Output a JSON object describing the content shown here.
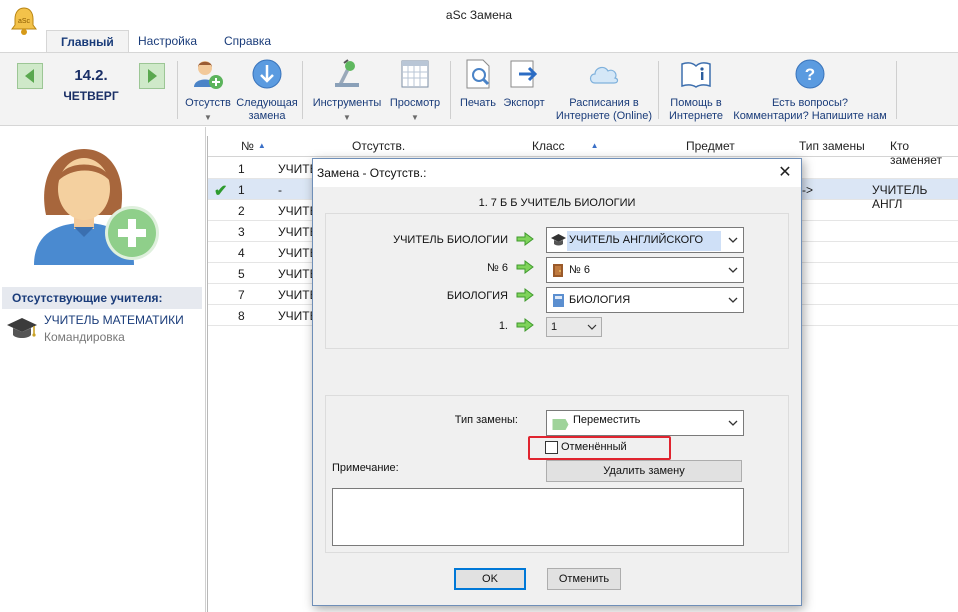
{
  "window": {
    "title": "aSc Замена"
  },
  "tabs": [
    {
      "label": "Главный"
    },
    {
      "label": "Настройка"
    },
    {
      "label": "Справка"
    }
  ],
  "ribbon": {
    "date": "14.2.",
    "weekday": "ЧЕТВЕРГ",
    "buttons": {
      "absent": {
        "line1": "Отсутств",
        "line2": ""
      },
      "next": {
        "line1": "Следующая",
        "line2": "замена"
      },
      "tools": {
        "line1": "Инструменты",
        "line2": ""
      },
      "view": {
        "line1": "Просмотр",
        "line2": ""
      },
      "print": {
        "line1": "Печать",
        "line2": ""
      },
      "export": {
        "line1": "Экспорт",
        "line2": ""
      },
      "online": {
        "line1": "Расписания в",
        "line2": "Интернете (Online)"
      },
      "help": {
        "line1": "Помощь в",
        "line2": "Интернете"
      },
      "questions": {
        "line1": "Есть вопросы?",
        "line2": "Комментарии? Напишите нам"
      }
    }
  },
  "left_panel": {
    "absent_header": "Отсутствующие учителя:",
    "absent_teachers": [
      {
        "name": "УЧИТЕЛЬ МАТЕМАТИКИ",
        "reason": "Командировка"
      }
    ]
  },
  "grid": {
    "columns": [
      "№",
      "Отсутств.",
      "Класс",
      "Предмет",
      "Тип замены",
      "Кто заменяет"
    ],
    "rows": [
      {
        "num": "1",
        "teacher": "УЧИТЕ",
        "check": "",
        "arrow": "",
        "kto": ""
      },
      {
        "num": "1",
        "teacher": "-",
        "check": "✔",
        "arrow": "->",
        "kto": "УЧИТЕЛЬ АНГЛ"
      },
      {
        "num": "2",
        "teacher": "УЧИТЕ",
        "check": "",
        "arrow": "",
        "kto": ""
      },
      {
        "num": "3",
        "teacher": "УЧИТЕ",
        "check": "",
        "arrow": "",
        "kto": ""
      },
      {
        "num": "4",
        "teacher": "УЧИТЕ",
        "check": "",
        "arrow": "",
        "kto": ""
      },
      {
        "num": "5",
        "teacher": "УЧИТЕ",
        "check": "",
        "arrow": "",
        "kto": ""
      },
      {
        "num": "7",
        "teacher": "УЧИТЕ",
        "check": "",
        "arrow": "",
        "kto": ""
      },
      {
        "num": "8",
        "teacher": "УЧИТЕ",
        "check": "",
        "arrow": "",
        "kto": ""
      }
    ]
  },
  "dialog": {
    "title": "Замена - Отсутств.:",
    "heading": "1. 7 Б  Б УЧИТЕЛЬ БИОЛОГИИ",
    "rows": {
      "teacher_from": "УЧИТЕЛЬ БИОЛОГИИ",
      "teacher_to": "УЧИТЕЛЬ АНГЛИЙСКОГО",
      "room_from": "№ 6",
      "room_to": "№ 6",
      "subject_from": "БИОЛОГИЯ",
      "subject_to": "БИОЛОГИЯ",
      "period_from": "1.",
      "period_to": "1"
    },
    "type_label": "Тип замены:",
    "type_value": "Переместить",
    "cancelled_label": "Отменённый",
    "cancelled_checked": false,
    "note_label": "Примечание:",
    "delete_button": "Удалить замену",
    "note_value": "",
    "ok": "OK",
    "cancel": "Отменить"
  },
  "colors": {
    "accent": "#1a3c7a",
    "nav_green": "#cfe9c9",
    "highlight_red": "#e0242f",
    "selected_row": "#dbe6f5"
  },
  "icons": {
    "app": "bell-icon",
    "absent": "user-add-icon",
    "next": "arrow-down-circle-icon",
    "tools": "tools-icon",
    "view": "table-view-icon",
    "print": "print-preview-icon",
    "export": "export-icon",
    "online": "cloud-icon",
    "help": "book-info-icon",
    "questions": "question-circle-icon"
  }
}
